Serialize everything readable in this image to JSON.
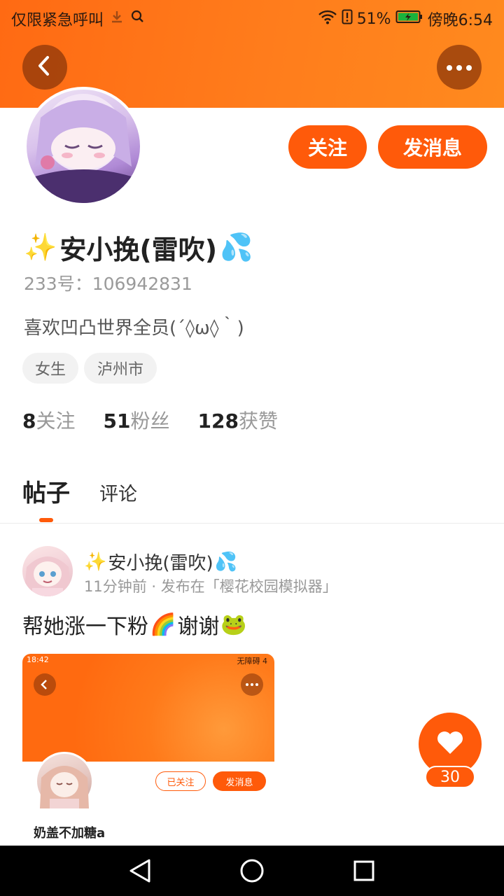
{
  "status_bar": {
    "carrier_text": "仅限紧急呼叫",
    "battery": "51%",
    "time": "傍晚6:54",
    "icons": [
      "download-icon",
      "search-icon",
      "wifi-icon",
      "sim-alert-icon",
      "battery-icon"
    ]
  },
  "header": {
    "back_icon": "chevron-left-icon",
    "more_icon": "more-dots-icon",
    "accent": "#ff5a0a"
  },
  "profile": {
    "follow_label": "关注",
    "message_label": "发消息",
    "nickname": "安小挽(雷吹)",
    "nickname_prefix_emoji": "✨",
    "nickname_suffix_emoji": "💦",
    "uid": "233号：106942831",
    "bio": "喜欢凹凸世界全员(´◊ω◊｀)",
    "tags": [
      "女生",
      "泸州市"
    ],
    "stats": [
      {
        "num": "8",
        "label": "关注"
      },
      {
        "num": "51",
        "label": "粉丝"
      },
      {
        "num": "128",
        "label": "获赞"
      }
    ]
  },
  "tabs": {
    "posts": "帖子",
    "comments": "评论"
  },
  "post": {
    "author_prefix_emoji": "✨",
    "author": "安小挽(雷吹)",
    "author_suffix_emoji": "💦",
    "meta": "11分钟前 · 发布在「樱花校园模拟器」",
    "text": "帮她涨一下粉",
    "text_emoji_1": "🌈",
    "text_2": "谢谢",
    "text_emoji_2": "🐸",
    "screenshot": {
      "time": "18:42",
      "status_right": "无障碍 4",
      "followed_label": "已关注",
      "message_label": "发消息",
      "name": "奶盖不加糖a"
    }
  },
  "like": {
    "count": "30"
  }
}
